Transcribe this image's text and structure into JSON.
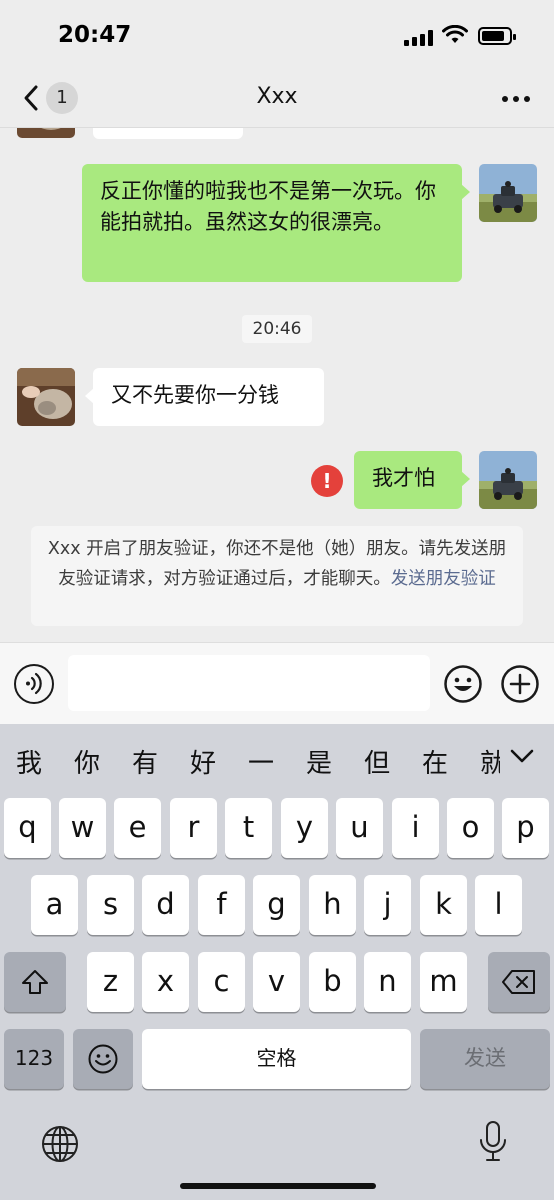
{
  "status_bar": {
    "time": "20:47"
  },
  "nav": {
    "back_badge": "1",
    "title": "Xxx"
  },
  "chat": {
    "messages": [
      {
        "direction": "out",
        "text": "反正你懂的啦我也不是第一次玩。你能拍就拍。虽然这女的很漂亮。"
      },
      {
        "direction": "in",
        "text": "又不先要你一分钱"
      },
      {
        "direction": "out",
        "text": "我才怕",
        "status": "failed"
      }
    ],
    "timestamp": "20:46",
    "error_mark": "!",
    "system_notice": {
      "text": "Xxx 开启了朋友验证，你还不是他（她）朋友。请先发送朋友验证请求，对方验证通过后，才能聊天。",
      "link": "发送朋友验证"
    }
  },
  "input": {
    "placeholder": ""
  },
  "keyboard": {
    "candidates": [
      "我",
      "你",
      "有",
      "好",
      "一",
      "是",
      "但",
      "在",
      "就"
    ],
    "row1": [
      "q",
      "w",
      "e",
      "r",
      "t",
      "y",
      "u",
      "i",
      "o",
      "p"
    ],
    "row2": [
      "a",
      "s",
      "d",
      "f",
      "g",
      "h",
      "j",
      "k",
      "l"
    ],
    "row3": [
      "z",
      "x",
      "c",
      "v",
      "b",
      "n",
      "m"
    ],
    "numbers_key": "123",
    "space_key": "空格",
    "send_key": "发送"
  },
  "colors": {
    "outgoing_bubble": "#a9e97f",
    "incoming_bubble": "#ffffff",
    "error": "#e4413b",
    "link": "#5b6b90"
  },
  "icons": [
    "back-icon",
    "more-icon",
    "voice-icon",
    "emoji-icon",
    "plus-icon",
    "shift-icon",
    "backspace-icon",
    "emoji-keyboard-icon",
    "globe-icon",
    "mic-icon"
  ]
}
